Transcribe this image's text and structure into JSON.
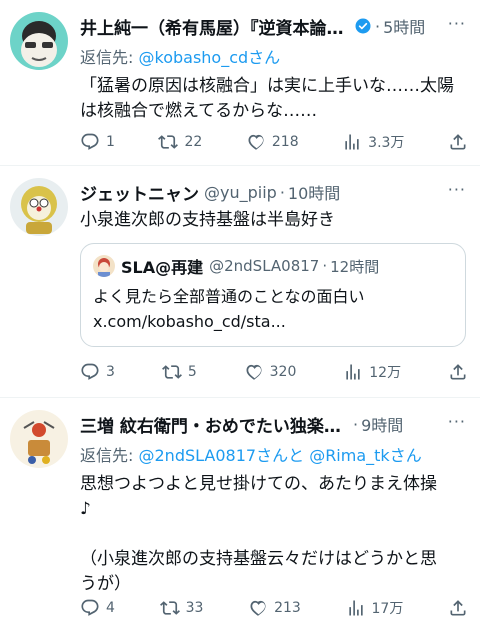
{
  "tweets": [
    {
      "name": "井上純一（希有馬屋）『逆資本論』...",
      "verified": true,
      "time": "5時間",
      "reply_label": "返信先:",
      "reply_to": "@kobasho_cd",
      "reply_suffix": "さん",
      "text1": "「猛暑の原因は核融合」は実に上手いな……太陽",
      "text2": "は核融合で燃えてるからな……",
      "replies": "1",
      "retweets": "22",
      "likes": "218",
      "views": "3.3万"
    },
    {
      "name": "ジェットニャン",
      "handle": "@yu_piip",
      "time": "10時間",
      "text1": "小泉進次郎の支持基盤は半島好き",
      "quote": {
        "name": "SLA@再建",
        "handle": "@2ndSLA0817",
        "time": "12時間",
        "text1": "よく見たら全部普通のことなの面白い",
        "text2": "x.com/kobasho_cd/sta..."
      },
      "replies": "3",
      "retweets": "5",
      "likes": "320",
      "views": "12万"
    },
    {
      "name": "三増 紋右衛門・おめでたい独楽（...",
      "time": "9時間",
      "reply_label": "返信先:",
      "reply_to": "@2ndSLA0817",
      "reply_mid": "さんと",
      "reply_to2": "@Rima_tk",
      "reply_suffix": "さん",
      "text1": "思想つよつよと見せ掛けての、あたりまえ体操",
      "text2": "♪",
      "text3": "（小泉進次郎の支持基盤云々だけはどうかと思",
      "text4": "うが）",
      "replies": "4",
      "retweets": "33",
      "likes": "213",
      "views": "17万"
    }
  ],
  "dot": "·",
  "more": "···",
  "colors": {
    "accent": "#1d9bf0",
    "secondary_text": "#536471",
    "border": "#eff3f4"
  },
  "icons": [
    "reply-icon",
    "retweet-icon",
    "like-icon",
    "views-icon",
    "share-icon",
    "verified-badge-icon",
    "more-icon"
  ]
}
